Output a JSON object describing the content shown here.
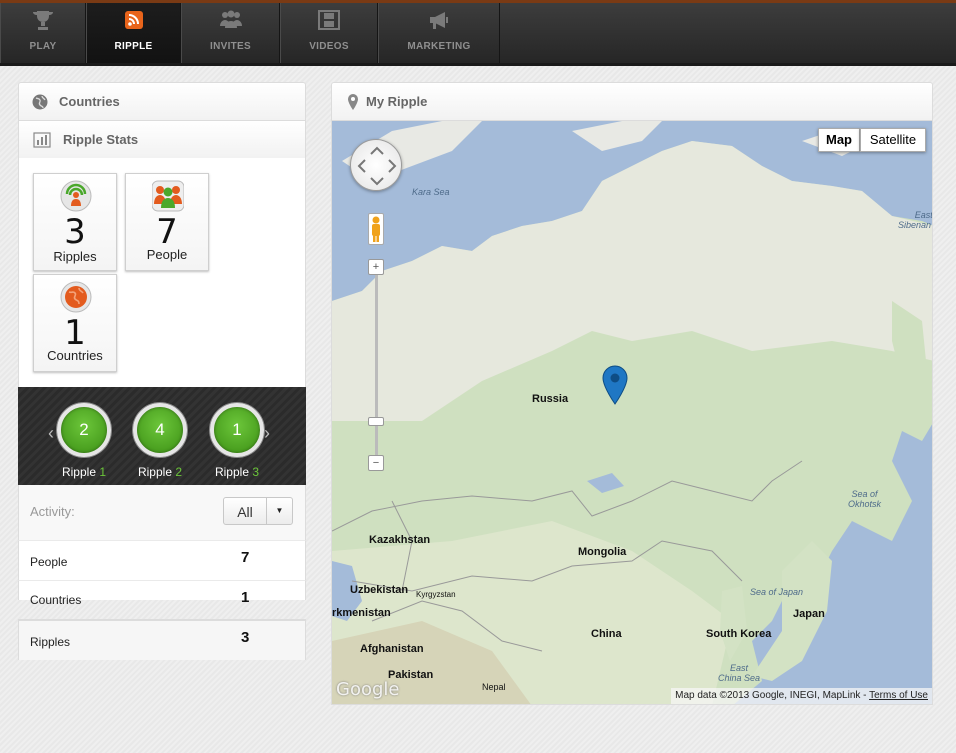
{
  "nav": {
    "tabs": [
      {
        "label": "PLAY",
        "icon": "trophy-icon"
      },
      {
        "label": "RIPPLE",
        "icon": "rss-icon",
        "active": true
      },
      {
        "label": "INVITES",
        "icon": "people-icon"
      },
      {
        "label": "VIDEOS",
        "icon": "film-icon"
      },
      {
        "label": "MARKETING",
        "icon": "megaphone-icon"
      }
    ],
    "accent_color": "#e8641b"
  },
  "left": {
    "countries_header": "Countries",
    "stats_header": "Ripple Stats",
    "stats": [
      {
        "value": "3",
        "label": "Ripples"
      },
      {
        "value": "7",
        "label": "People"
      },
      {
        "value": "1",
        "label": "Countries"
      }
    ],
    "ripples": [
      {
        "value": "2",
        "label": "Ripple",
        "num": "1"
      },
      {
        "value": "4",
        "label": "Ripple",
        "num": "2"
      },
      {
        "value": "1",
        "label": "Ripple",
        "num": "3"
      }
    ],
    "activity_label": "Activity:",
    "activity_filter": "All",
    "rows": [
      {
        "label": "People",
        "value": "7"
      },
      {
        "label": "Countries",
        "value": "1"
      },
      {
        "label": "Ripples",
        "value": "3"
      }
    ]
  },
  "map": {
    "header": "My Ripple",
    "type_map": "Map",
    "type_satellite": "Satellite",
    "labels": {
      "russia": "Russia",
      "kazakhstan": "Kazakhstan",
      "mongolia": "Mongolia",
      "uzbekistan": "Uzbekistan",
      "kyrgyzstan": "Kyrgyzstan",
      "turkmenistan": "rkmenistan",
      "afghanistan": "Afghanistan",
      "pakistan": "Pakistan",
      "nepal": "Nepal",
      "china": "China",
      "south_korea": "South Korea",
      "japan": "Japan"
    },
    "seas": {
      "kara": "Kara Sea",
      "east_siberian": "East\nSibenan Sea",
      "okhotsk": "Sea of\nOkhotsk",
      "japan_sea": "Sea of Japan",
      "east_china": "East\nChina Sea"
    },
    "zoom_in": "+",
    "zoom_out": "−",
    "google_logo": "Google",
    "attribution": "Map data ©2013 Google, INEGI, MapLink - ",
    "terms": "Terms of Use"
  }
}
